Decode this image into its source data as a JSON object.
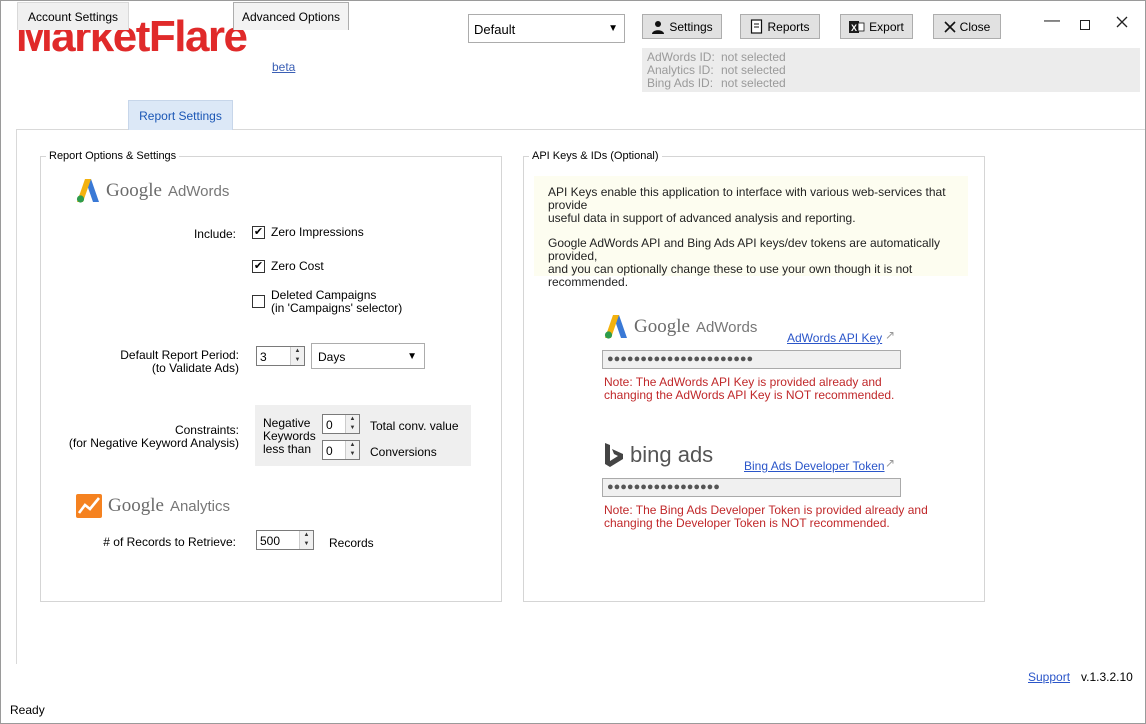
{
  "app": {
    "logo": "MarketFlare",
    "beta_link": "beta"
  },
  "toolbar": {
    "profile_value": "Default",
    "settings_label": "Settings",
    "reports_label": "Reports",
    "export_label": "Export",
    "close_label": "Close"
  },
  "ids": [
    {
      "label": "AdWords ID:",
      "value": "not selected"
    },
    {
      "label": "Analytics ID:",
      "value": "not selected"
    },
    {
      "label": "Bing Ads ID:",
      "value": "not selected"
    }
  ],
  "tabs": [
    {
      "label": "Account Settings"
    },
    {
      "label": "Report Settings"
    },
    {
      "label": "Advanced Options"
    }
  ],
  "report_options": {
    "title": "Report Options & Settings",
    "adwords_brand": "Google",
    "adwords_sub": "AdWords",
    "include_label": "Include:",
    "zero_impressions": "Zero Impressions",
    "zero_impressions_checked": true,
    "zero_cost": "Zero Cost",
    "zero_cost_checked": true,
    "deleted_campaigns_1": "Deleted Campaigns",
    "deleted_campaigns_2": "(in 'Campaigns' selector)",
    "deleted_campaigns_checked": false,
    "period_label_1": "Default Report Period:",
    "period_label_2": "(to Validate Ads)",
    "period_value": "3",
    "period_unit": "Days",
    "constraints_label_1": "Constraints:",
    "constraints_label_2": "(for Negative Keyword Analysis)",
    "neg_1": "Negative",
    "neg_2": "Keywords",
    "neg_3": "less than",
    "conv_value": "0",
    "conv_value_label": "Total conv. value",
    "conversions": "0",
    "conversions_label": "Conversions",
    "analytics_brand": "Google",
    "analytics_sub": "Analytics",
    "records_label": "# of Records to Retrieve:",
    "records_value": "500",
    "records_unit": "Records"
  },
  "api_keys": {
    "title": "API Keys & IDs (Optional)",
    "info_1": "API Keys enable this application to interface with various web-services that provide",
    "info_2": "useful data in support of advanced analysis and reporting.",
    "info_3": "Google AdWords API and Bing Ads API keys/dev tokens are automatically provided,",
    "info_4": "and you can optionally change these to use your own though it is not recommended.",
    "adwords_brand": "Google",
    "adwords_sub": "AdWords",
    "adwords_link": "AdWords API Key",
    "adwords_key": "●●●●●●●●●●●●●●●●●●●●●●",
    "adwords_note_1": "Note: The AdWords API Key is provided already and",
    "adwords_note_2": "changing the AdWords API Key is NOT recommended.",
    "bing_brand": "bing ads",
    "bing_link": "Bing Ads Developer Token",
    "bing_key": "●●●●●●●●●●●●●●●●●",
    "bing_note_1": "Note: The Bing Ads Developer Token is provided already and",
    "bing_note_2": "changing the Developer Token is NOT recommended."
  },
  "footer": {
    "support": "Support",
    "version": "v.1.3.2.10",
    "status": "Ready"
  },
  "colors": {
    "logo": "#e02a2a",
    "link": "#2a55c9",
    "note": "#c0282a",
    "active_tab": "#dce8f7"
  }
}
